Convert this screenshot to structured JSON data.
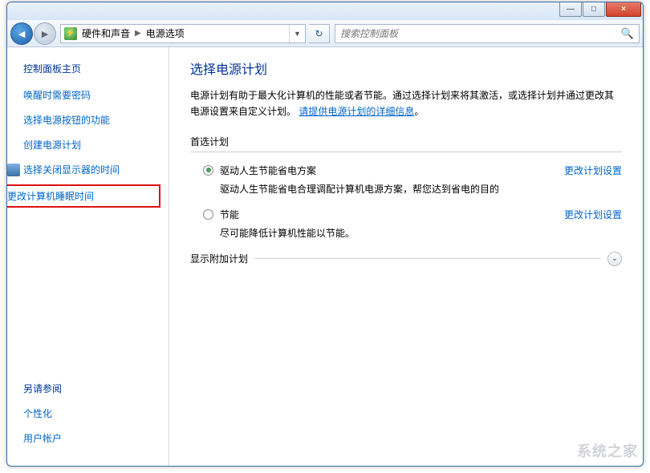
{
  "titlebar": {
    "minimize": "—",
    "maximize": "□",
    "close": "×"
  },
  "nav": {
    "back": "◄",
    "forward": "►"
  },
  "address": {
    "segment1": "硬件和声音",
    "segment2": "电源选项",
    "dropdown": "▼"
  },
  "refresh": "↻",
  "search": {
    "placeholder": "搜索控制面板",
    "icon": "🔍"
  },
  "sidebar": {
    "home": "控制面板主页",
    "links": [
      {
        "label": "唤醒时需要密码"
      },
      {
        "label": "选择电源按钮的功能"
      },
      {
        "label": "创建电源计划"
      },
      {
        "label": "选择关闭显示器的时间",
        "icon": "monitor"
      },
      {
        "label": "更改计算机睡眠时间",
        "icon": "moon",
        "highlighted": true
      }
    ],
    "see_also": "另请参阅",
    "footer_links": [
      {
        "label": "个性化"
      },
      {
        "label": "用户帐户"
      }
    ]
  },
  "main": {
    "heading": "选择电源计划",
    "description_prefix": "电源计划有助于最大化计算机的性能或者节能。通过选择计划来将其激活，或选择计划并通过更改其电源设置来自定义计划。",
    "description_link": "请提供电源计划的详细信息",
    "preferred_label": "首选计划",
    "plans": [
      {
        "name": "驱动人生节能省电方案",
        "desc": "驱动人生节能省电合理调配计算机电源方案，帮您达到省电的目的",
        "checked": true,
        "change": "更改计划设置"
      },
      {
        "name": "节能",
        "desc": "尽可能降低计算机性能以节能。",
        "checked": false,
        "change": "更改计划设置"
      }
    ],
    "additional_label": "显示附加计划",
    "expander_icon": "⌄"
  },
  "watermark": "系统之家"
}
